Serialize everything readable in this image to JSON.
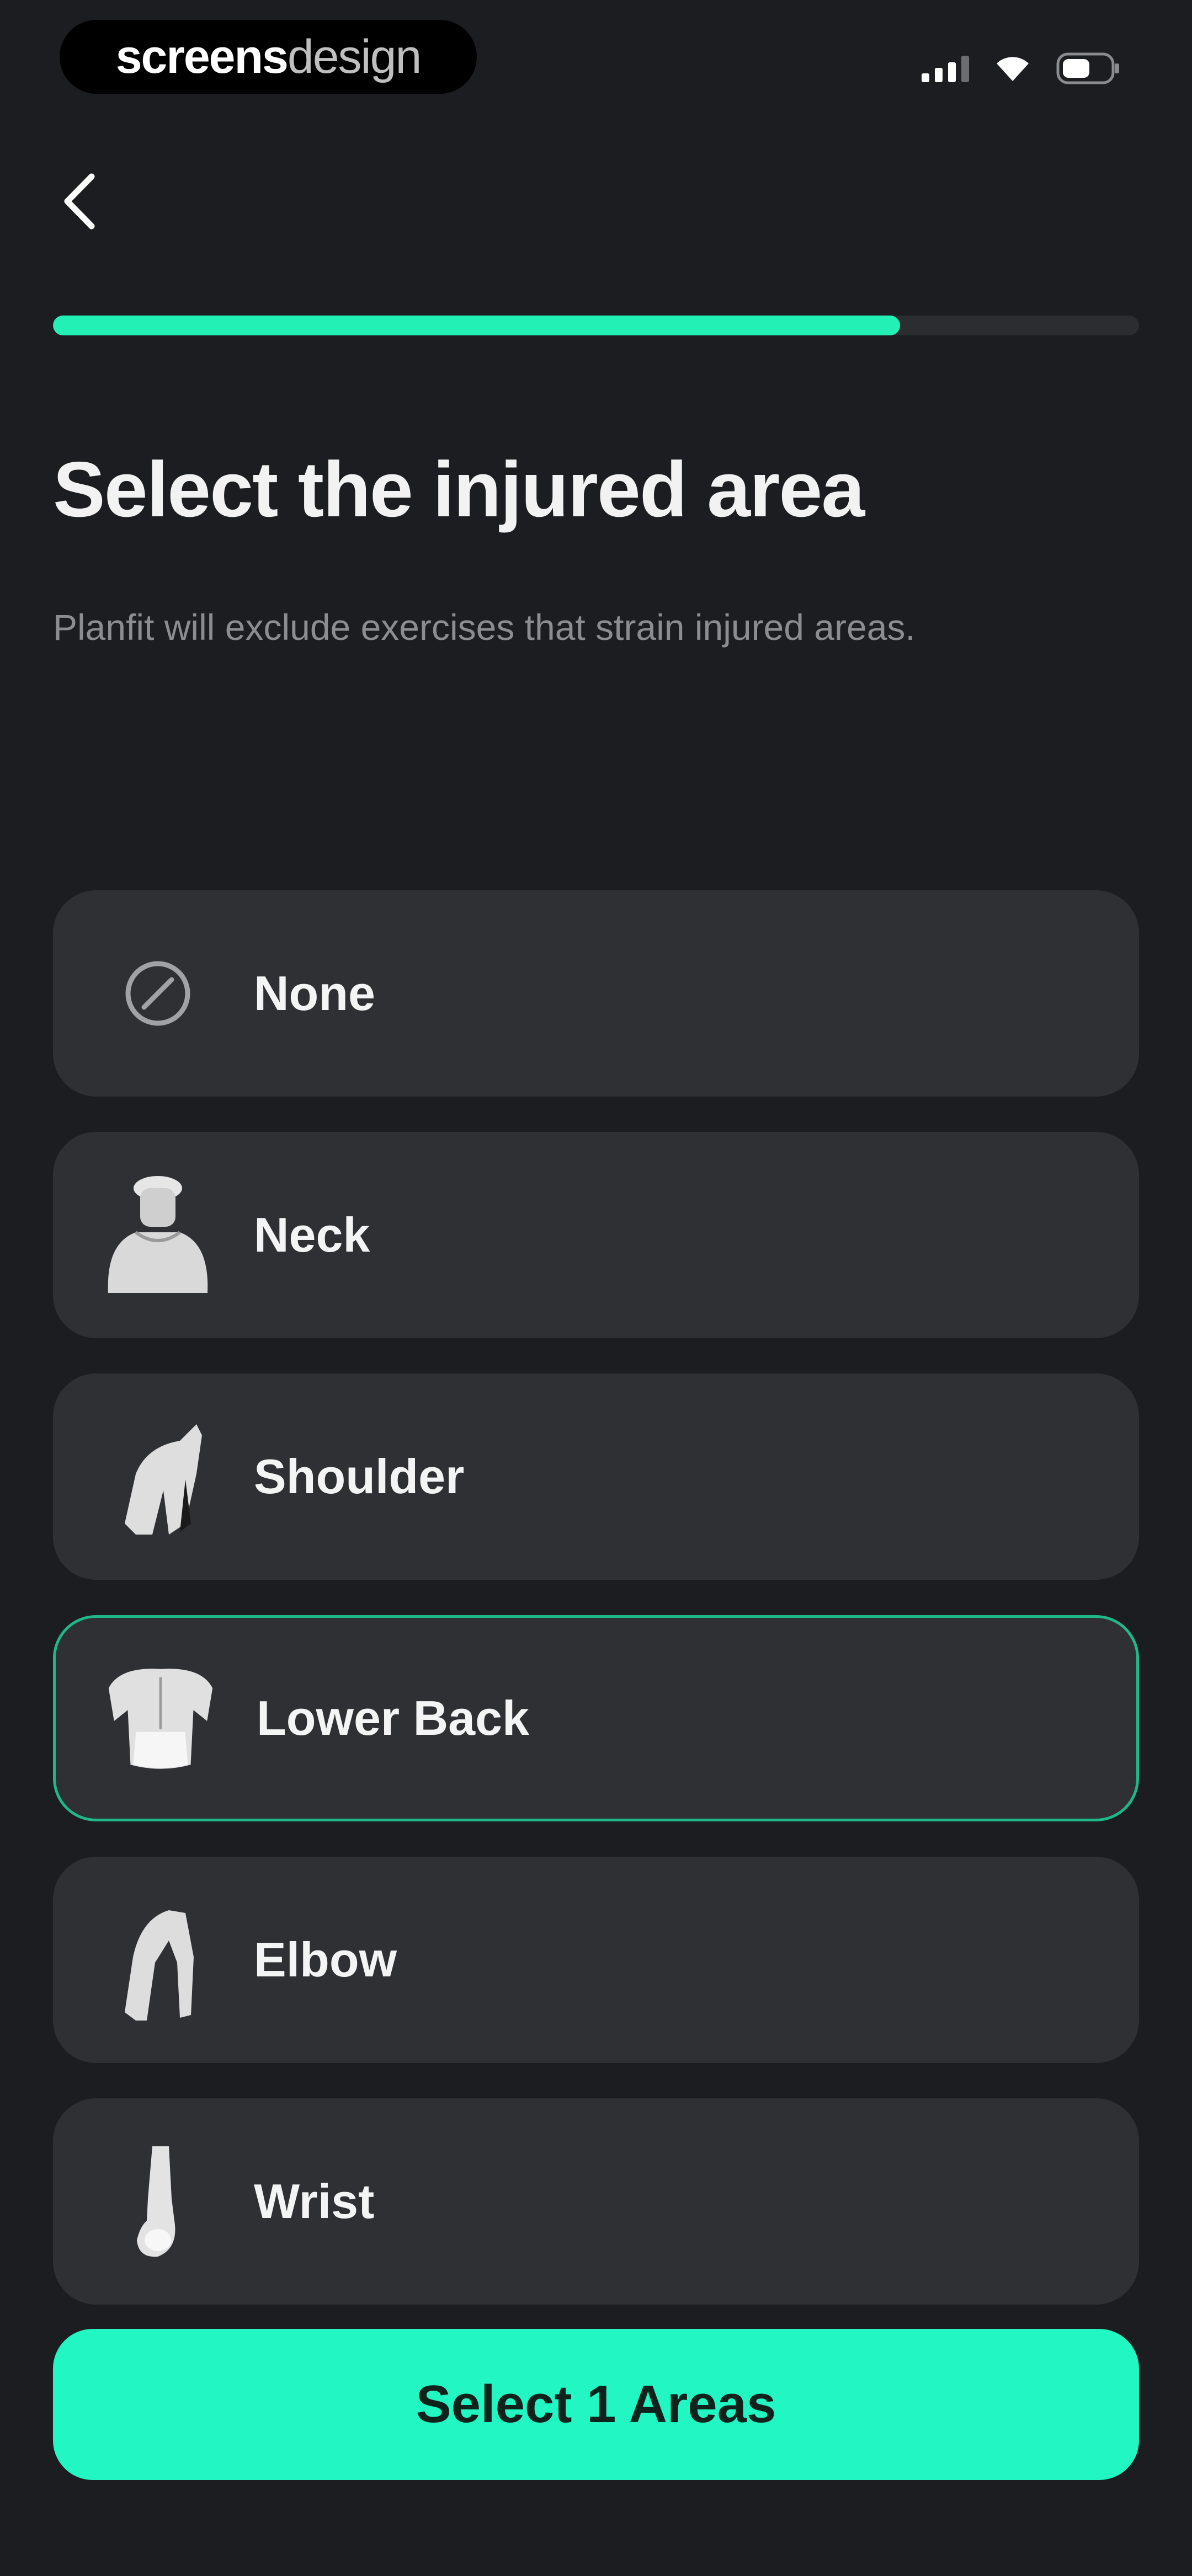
{
  "status_bar": {
    "brand_primary": "screens",
    "brand_secondary": "design"
  },
  "icons": {
    "back": "chevron-left-icon",
    "none": "prohibited-icon",
    "neck": "neck-body-icon",
    "shoulder": "shoulder-body-icon",
    "lower_back": "lower-back-body-icon",
    "elbow": "elbow-body-icon",
    "wrist": "wrist-body-icon"
  },
  "progress": {
    "fraction": 0.78
  },
  "header": {
    "title": "Select the injured area",
    "subtitle": "Planfit will exclude exercises that strain injured areas."
  },
  "options": [
    {
      "label": "None",
      "selected": false
    },
    {
      "label": "Neck",
      "selected": false
    },
    {
      "label": "Shoulder",
      "selected": false
    },
    {
      "label": "Lower Back",
      "selected": true
    },
    {
      "label": "Elbow",
      "selected": false
    },
    {
      "label": "Wrist",
      "selected": false
    }
  ],
  "cta": {
    "label": "Select 1 Areas"
  },
  "colors": {
    "accent": "#22f7c3",
    "background": "#1c1d20",
    "card": "#2e3034",
    "selected_border": "#1fb889"
  }
}
